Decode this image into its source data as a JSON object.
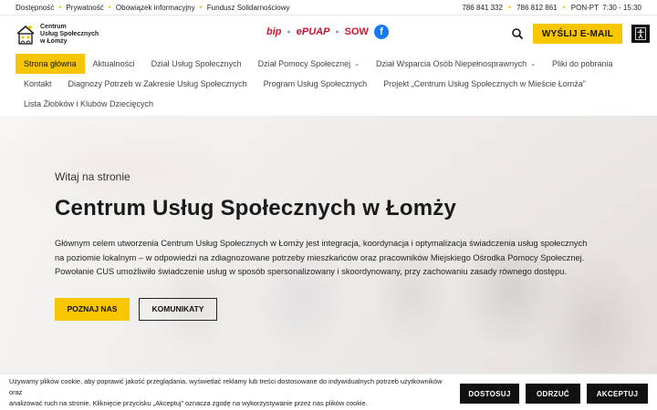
{
  "topbar": {
    "links": [
      "Dostępność",
      "Prywatność",
      "Obowiązek informacyjny",
      "Fundusz Solidarnościowy"
    ],
    "phone1": "786 841 332",
    "phone2": "786 812 861",
    "hours": "PON-PT  7:30 - 15:30"
  },
  "header": {
    "logo_line1": "Centrum",
    "logo_line2": "Usług Społecznych",
    "logo_line3": "w Łomży",
    "bip": "bip",
    "epuap": "ePUAP",
    "sow": "SOW",
    "facebook": "f",
    "email_button": "WYŚLIJ E-MAIL"
  },
  "nav": {
    "row1": [
      {
        "label": "Strona główna",
        "active": true
      },
      {
        "label": "Aktualności"
      },
      {
        "label": "Dział Usług Społecznych"
      },
      {
        "label": "Dział Pomocy Społecznej",
        "dropdown": true
      },
      {
        "label": "Dział Wsparcia Osób Niepełnosprawnych",
        "dropdown": true
      },
      {
        "label": "Pliki do pobrania"
      }
    ],
    "row2": [
      {
        "label": "Kontakt"
      },
      {
        "label": "Diagnozy Potrzeb w Zakresie Usług Społecznych"
      },
      {
        "label": "Program Usług Społecznych"
      },
      {
        "label": "Projekt „Centrum Usług Społecznych w Mieście Łomża”"
      }
    ],
    "row3": [
      {
        "label": "Lista Żłobków i Klubów Dziecięcych"
      }
    ]
  },
  "hero": {
    "eyebrow": "Witaj na stronie",
    "title": "Centrum Usług Społecznych w Łomży",
    "desc_line1": "Głównym celem utworzenia Centrum Usług Społecznych w Łomży jest integracja, koordynacja i optymalizacja świadczenia usług społecznych",
    "desc_line2": "na poziomie lokalnym – w odpowiedzi na zdiagnozowane potrzeby mieszkańców oraz pracowników Miejskiego Ośrodka Pomocy Społecznej.",
    "desc_line3": "Powołanie CUS umożliwiło świadczenie usług w sposób spersonalizowany i skoordynowany, przy zachowaniu zasady równego dostępu.",
    "primary_button": "POZNAJ NAS",
    "secondary_button": "KOMUNIKATY"
  },
  "cookie": {
    "text_line1": "Używamy plików cookie, aby poprawić jakość przeglądania, wyświetlać reklamy lub treści dostosowane do indywidualnych potrzeb użytkowników oraz",
    "text_line2": "analizować ruch na stronie. Kliknięcie przycisku „Akceptuj” oznacza zgodę na wykorzystywanie przez nas plików cookie.",
    "customize": "DOSTOSUJ",
    "reject": "ODRZUĆ",
    "accept": "AKCEPTUJ"
  },
  "colors": {
    "accent": "#f7c600",
    "dark": "#111111",
    "facebook": "#1877f2",
    "bip_red": "#d5142a"
  }
}
